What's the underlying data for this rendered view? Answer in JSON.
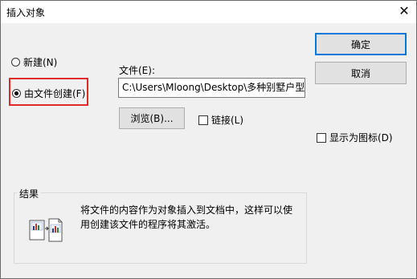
{
  "dialog": {
    "title": "插入对象",
    "close_glyph": "✕"
  },
  "options": {
    "create_new_label": "新建(N)",
    "create_from_file_label": "由文件创建(F)",
    "selected": "create_from_file"
  },
  "file": {
    "label": "文件(E):",
    "value": "C:\\Users\\Mloong\\Desktop\\多种别墅户型",
    "browse_label": "浏览(B)...",
    "link_label": "链接(L)",
    "link_checked": false
  },
  "buttons": {
    "ok_label": "确定",
    "cancel_label": "取消"
  },
  "display_as_icon": {
    "label": "显示为图标(D)",
    "checked": false
  },
  "result": {
    "title": "结果",
    "text": "将文件的内容作为对象插入到文档中，这样可以使用创建该文件的程序将其激活。"
  },
  "colors": {
    "highlight_border": "#e02a2a",
    "default_button_border": "#0078d7"
  },
  "icons": [
    "close-icon",
    "document-chart-icon"
  ]
}
